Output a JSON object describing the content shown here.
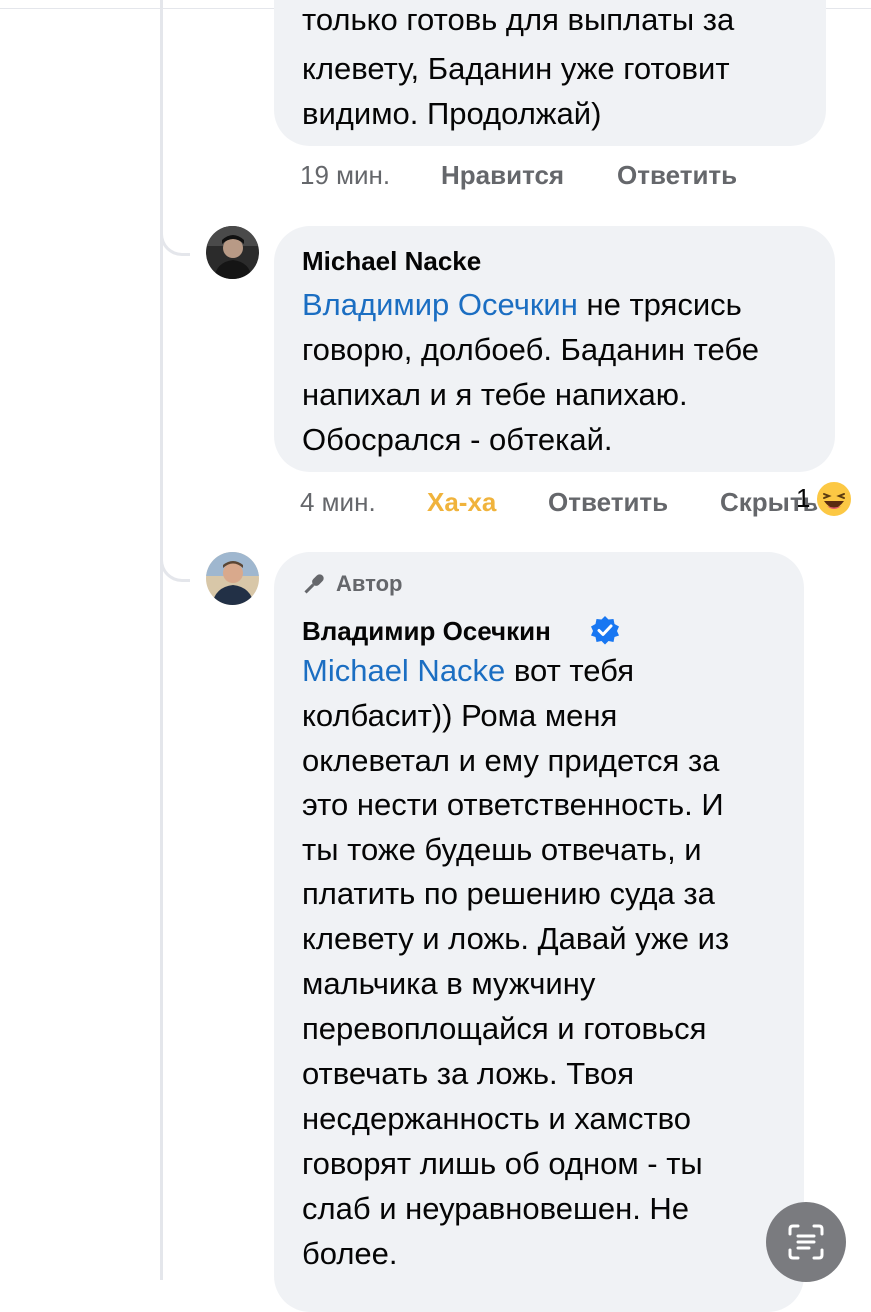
{
  "comment_prev": {
    "lines": [
      "только готовь для выплаты за",
      "клевету, Баданин уже готовит",
      "видимо. Продолжай)"
    ],
    "time": "19 мин.",
    "like_label": "Нравится",
    "reply_label": "Ответить"
  },
  "comment_michael": {
    "author": "Michael Nacke",
    "mention": "Владимир Осечкин",
    "line1_rest": " не трясись",
    "lines": [
      "говорю, долбоеб. Баданин тебе",
      "напихал и я тебе напихаю.",
      "Обосрался - обтекай."
    ],
    "time": "4 мин.",
    "reaction_label": "Ха-ха",
    "reply_label": "Ответить",
    "hide_label": "Скрыть",
    "reaction_count": "1",
    "reaction_emoji": "😆"
  },
  "comment_vladimir": {
    "badge": "Автор",
    "author": "Владимир Осечкин",
    "mention": "Michael Nacke",
    "line1_rest": " вот тебя",
    "lines": [
      "колбасит)) Рома меня",
      "оклеветал и ему придется за",
      "это нести ответственность. И",
      "ты тоже будешь отвечать, и",
      "платить по решению суда за",
      "клевету и ложь. Давай уже из",
      "мальчика в мужчину",
      "перевоплощайся и готовься",
      "отвечать за ложь. Твоя",
      "несдержанность и хамство",
      "говорят лишь об одном - ты",
      "слаб и неуравновешен. Не",
      "более."
    ]
  },
  "colors": {
    "bubble": "#f0f2f5",
    "mention": "#1b6ec2",
    "meta": "#65676b",
    "haha": "#f0b33c",
    "verified": "#1877f2"
  },
  "icons": {
    "badge_icon": "microphone-icon",
    "verified_icon": "verified-badge-icon",
    "scan_icon": "text-scan-icon"
  }
}
